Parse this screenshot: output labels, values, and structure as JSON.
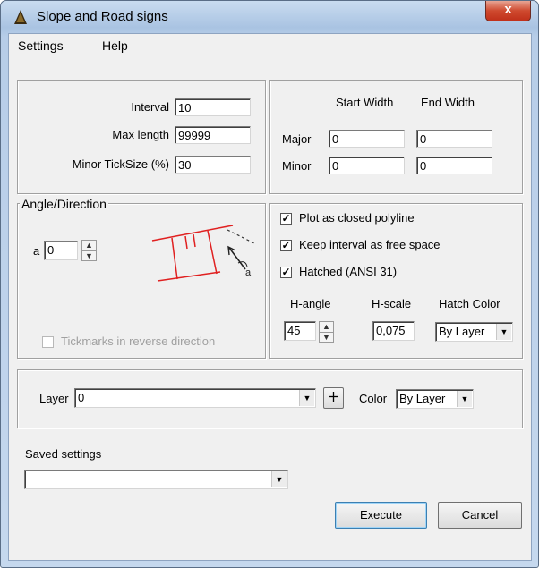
{
  "window": {
    "title": "Slope and Road signs",
    "close_label": "x"
  },
  "menu": {
    "items": [
      "Settings",
      "Help"
    ]
  },
  "params": {
    "interval_label": "Interval",
    "interval_value": "10",
    "maxlength_label": "Max length",
    "maxlength_value": "99999",
    "minortick_label": "Minor TickSize (%)",
    "minortick_value": "30"
  },
  "widths": {
    "start_header": "Start Width",
    "end_header": "End Width",
    "major_label": "Major",
    "major_start": "0",
    "major_end": "0",
    "minor_label": "Minor",
    "minor_start": "0",
    "minor_end": "0"
  },
  "angle": {
    "group_title": "Angle/Direction",
    "a_label": "a",
    "a_value": "0",
    "reverse_label": "Tickmarks in reverse direction",
    "reverse_checked": false,
    "preview_label": "a"
  },
  "options": {
    "closed_label": "Plot as closed polyline",
    "closed_checked": true,
    "free_label": "Keep interval as free space",
    "free_checked": true,
    "hatched_label": "Hatched (ANSI 31)",
    "hatched_checked": true,
    "hangle_label": "H-angle",
    "hangle_value": "45",
    "hscale_label": "H-scale",
    "hscale_value": "0,075",
    "hatchcolor_label": "Hatch Color",
    "hatchcolor_value": "By Layer"
  },
  "layer": {
    "layer_label": "Layer",
    "layer_value": "0",
    "color_label": "Color",
    "color_value": "By Layer",
    "pick_icon": "crosshair-icon"
  },
  "saved": {
    "label": "Saved settings",
    "value": ""
  },
  "buttons": {
    "execute": "Execute",
    "cancel": "Cancel"
  },
  "colors": {
    "preview_red": "#e02020",
    "title_bg": "#b9d1ea",
    "close_red": "#c8452c"
  }
}
